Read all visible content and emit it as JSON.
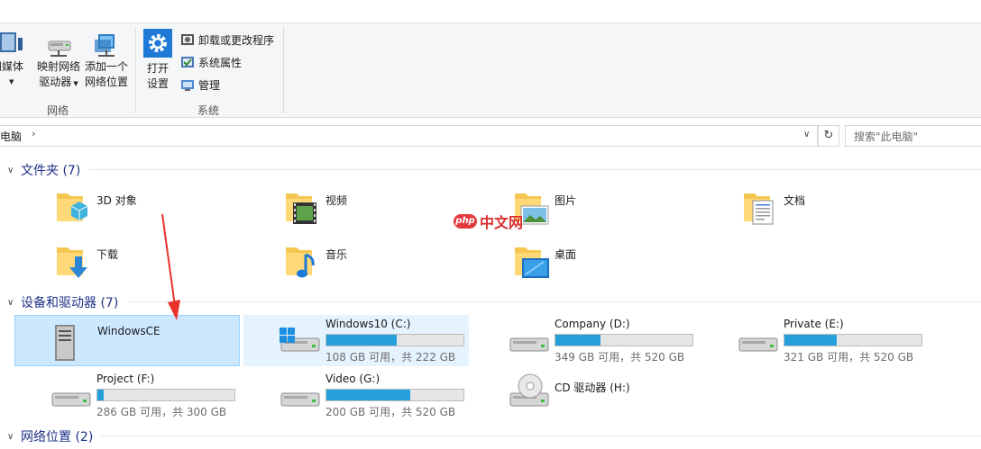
{
  "ribbon": {
    "media_label": "问媒体",
    "map_drive_label_1": "映射网络",
    "map_drive_label_2": "驱动器",
    "add_location_label_1": "添加一个",
    "add_location_label_2": "网络位置",
    "open_settings_label_1": "打开",
    "open_settings_label_2": "设置",
    "uninstall_label": "卸载或更改程序",
    "system_properties_label": "系统属性",
    "manage_label": "管理",
    "group_network": "网络",
    "group_system": "系统"
  },
  "address": {
    "path": "电脑",
    "chevron": "›",
    "search_placeholder": "搜索\"此电脑\""
  },
  "sections": {
    "folders": "文件夹 (7)",
    "devices": "设备和驱动器 (7)",
    "network": "网络位置 (2)"
  },
  "folders": [
    {
      "label": "3D 对象",
      "icon": "3d-objects-folder-icon"
    },
    {
      "label": "视频",
      "icon": "videos-folder-icon"
    },
    {
      "label": "图片",
      "icon": "pictures-folder-icon"
    },
    {
      "label": "文档",
      "icon": "documents-folder-icon"
    },
    {
      "label": "下载",
      "icon": "downloads-folder-icon"
    },
    {
      "label": "音乐",
      "icon": "music-folder-icon"
    },
    {
      "label": "桌面",
      "icon": "desktop-folder-icon"
    }
  ],
  "drives": [
    {
      "name": "WindowsCE",
      "free": "",
      "used_fraction": null,
      "state": "selected"
    },
    {
      "name": "Windows10 (C:)",
      "free": "108 GB 可用，共 222 GB",
      "used_fraction": 0.514,
      "state": "hover"
    },
    {
      "name": "Company (D:)",
      "free": "349 GB 可用，共 520 GB",
      "used_fraction": 0.329,
      "state": ""
    },
    {
      "name": "Private (E:)",
      "free": "321 GB 可用，共 520 GB",
      "used_fraction": 0.383,
      "state": ""
    },
    {
      "name": "Project (F:)",
      "free": "286 GB 可用，共 300 GB",
      "used_fraction": 0.047,
      "state": ""
    },
    {
      "name": "Video (G:)",
      "free": "200 GB 可用，共 520 GB",
      "used_fraction": 0.615,
      "state": ""
    },
    {
      "name": "CD 驱动器 (H:)",
      "free": "",
      "used_fraction": null,
      "state": ""
    }
  ],
  "watermark": "中文网",
  "watermark_logo": "php",
  "colors": {
    "accent": "#26a0da",
    "section_title": "#1e3287",
    "selection": "#cce8ff",
    "annotation_arrow": "#e8322a"
  }
}
